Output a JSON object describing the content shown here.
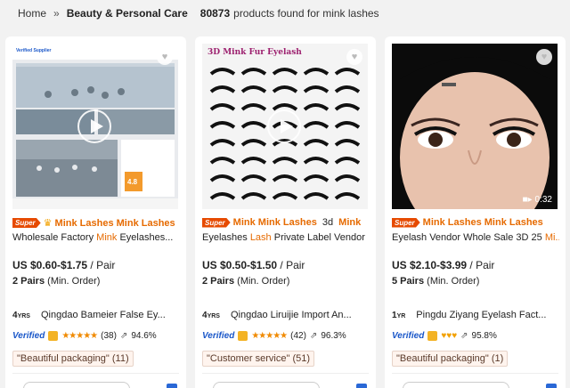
{
  "breadcrumb": {
    "home": "Home",
    "separator": "»",
    "category": "Beauty & Personal Care",
    "count": "80873",
    "found_text": "products found for mink lashes"
  },
  "colors": {
    "accent": "#e66a00",
    "super": "#e64a00",
    "verified": "#1a57c9",
    "price": "#222222"
  },
  "products": [
    {
      "super_label": "Super",
      "title_line1": [
        {
          "text": "Mink Lashes Mink Lashes",
          "kw": true
        }
      ],
      "title_line2": [
        {
          "text": "Wholesale Factory ",
          "kw": false
        },
        {
          "text": "Mink",
          "kw": true
        },
        {
          "text": " Eyelashes...",
          "kw": false
        }
      ],
      "price": "US $0.60-$1.75",
      "unit": "/ Pair",
      "moq_qty": "2 Pairs",
      "moq_label": "(Min. Order)",
      "years": "4",
      "years_unit": "YRS",
      "supplier": "Qingdao Bameier False Ey...",
      "verified": "Verified",
      "rating_icon": "stars",
      "review_count": "(38)",
      "response_rate": "94.6%",
      "review_tag": "\"Beautiful packaging\" (11)",
      "has_video": true,
      "thumbnail": {
        "caption": "Verified Supplier",
        "score": "4.8"
      }
    },
    {
      "super_label": "Super",
      "title_line1": [
        {
          "text": "Mink Mink Lashes",
          "kw": true
        },
        {
          "text": " 3d ",
          "kw": false
        },
        {
          "text": "Mink",
          "kw": true
        }
      ],
      "title_line2": [
        {
          "text": "Eyelashes ",
          "kw": false
        },
        {
          "text": "Lash",
          "kw": true
        },
        {
          "text": " Private Label Vendor",
          "kw": false
        }
      ],
      "price": "US $0.50-$1.50",
      "unit": "/ Pair",
      "moq_qty": "2 Pairs",
      "moq_label": "(Min. Order)",
      "years": "4",
      "years_unit": "YRS",
      "supplier": "Qingdao Liruijie Import An...",
      "verified": "Verified",
      "rating_icon": "stars",
      "review_count": "(42)",
      "response_rate": "96.3%",
      "review_tag": "\"Customer service\" (51)",
      "has_video": true,
      "thumbnail": {
        "caption": "3D Mink Fur Eyelash"
      }
    },
    {
      "super_label": "Super",
      "title_line1": [
        {
          "text": "Mink Lashes Mink Lashes",
          "kw": true
        }
      ],
      "title_line2": [
        {
          "text": "Eyelash Vendor Whole Sale 3D 25 ",
          "kw": false
        },
        {
          "text": "Mi...",
          "kw": true
        }
      ],
      "price": "US $2.10-$3.99",
      "unit": "/ Pair",
      "moq_qty": "5 Pairs",
      "moq_label": "(Min. Order)",
      "years": "1",
      "years_unit": "YR",
      "supplier": "Pingdu Ziyang Eyelash Fact...",
      "verified": "Verified",
      "rating_icon": "hearts",
      "review_count": "",
      "response_rate": "95.8%",
      "review_tag": "\"Beautiful packaging\" (1)",
      "has_video": false,
      "video_duration": "0:32"
    }
  ]
}
